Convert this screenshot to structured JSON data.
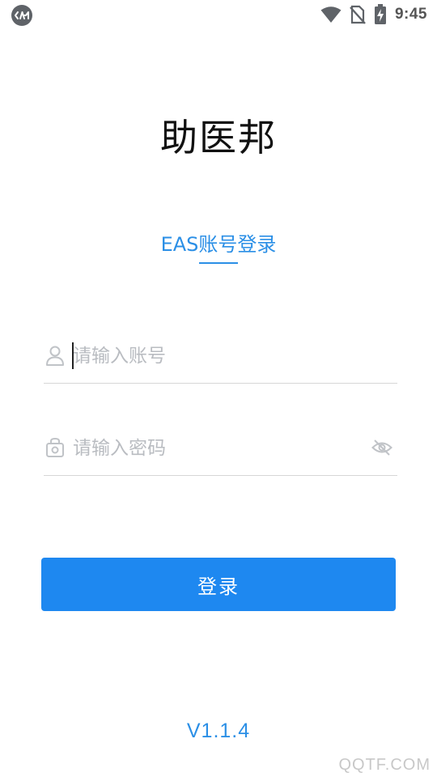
{
  "status_bar": {
    "time": "9:45",
    "left_icon": "app-notification-icon",
    "icons": [
      "wifi-icon",
      "no-sim-icon",
      "battery-charging-icon"
    ]
  },
  "app": {
    "title": "助医邦"
  },
  "login_tab": {
    "label": "EAS账号登录"
  },
  "account_field": {
    "icon": "user-icon",
    "placeholder": "请输入账号",
    "value": ""
  },
  "password_field": {
    "icon": "lock-icon",
    "placeholder": "请输入密码",
    "value": "",
    "toggle_icon": "eye-hidden-icon"
  },
  "login_button": {
    "label": "登录"
  },
  "version": "V1.1.4",
  "watermark": "QQTF.COM",
  "colors": {
    "accent": "#2b8fe6",
    "button": "#1e88f0",
    "placeholder": "#b9bcc1",
    "divider": "#d6d6d6"
  }
}
